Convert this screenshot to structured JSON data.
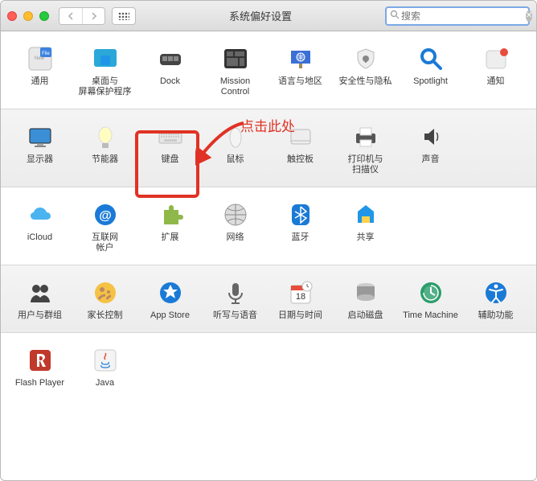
{
  "window_title": "系统偏好设置",
  "search": {
    "placeholder": "搜索"
  },
  "annotation": {
    "text": "点击此处"
  },
  "sections": [
    {
      "row": [
        {
          "id": "general",
          "label": "通用"
        },
        {
          "id": "desktop",
          "label": "桌面与\n屏幕保护程序"
        },
        {
          "id": "dock",
          "label": "Dock"
        },
        {
          "id": "mission",
          "label": "Mission\nControl"
        },
        {
          "id": "lang",
          "label": "语言与地区"
        },
        {
          "id": "security",
          "label": "安全性与隐私"
        },
        {
          "id": "spotlight",
          "label": "Spotlight"
        },
        {
          "id": "notifications",
          "label": "通知"
        }
      ]
    },
    {
      "row": [
        {
          "id": "displays",
          "label": "显示器"
        },
        {
          "id": "energy",
          "label": "节能器"
        },
        {
          "id": "keyboard",
          "label": "键盘"
        },
        {
          "id": "mouse",
          "label": "鼠标"
        },
        {
          "id": "trackpad",
          "label": "触控板"
        },
        {
          "id": "printers",
          "label": "打印机与\n扫描仪"
        },
        {
          "id": "sound",
          "label": "声音"
        }
      ]
    },
    {
      "row": [
        {
          "id": "icloud",
          "label": "iCloud"
        },
        {
          "id": "internet",
          "label": "互联网\n帐户"
        },
        {
          "id": "extensions",
          "label": "扩展"
        },
        {
          "id": "network",
          "label": "网络"
        },
        {
          "id": "bluetooth",
          "label": "蓝牙"
        },
        {
          "id": "sharing",
          "label": "共享"
        }
      ]
    },
    {
      "row": [
        {
          "id": "users",
          "label": "用户与群组"
        },
        {
          "id": "parental",
          "label": "家长控制"
        },
        {
          "id": "appstore",
          "label": "App Store"
        },
        {
          "id": "dictation",
          "label": "听写与语音"
        },
        {
          "id": "datetime",
          "label": "日期与时间"
        },
        {
          "id": "startup",
          "label": "启动磁盘"
        },
        {
          "id": "timemachine",
          "label": "Time Machine"
        },
        {
          "id": "accessibility",
          "label": "辅助功能"
        }
      ]
    },
    {
      "row": [
        {
          "id": "flash",
          "label": "Flash Player"
        },
        {
          "id": "java",
          "label": "Java"
        }
      ]
    }
  ]
}
